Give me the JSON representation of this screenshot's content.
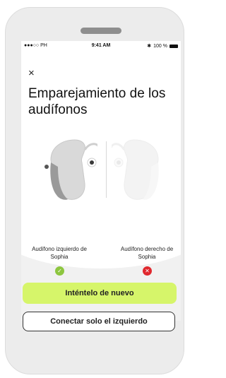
{
  "status_bar": {
    "carrier": "●●●○○ PH",
    "time": "9:41 AM",
    "battery": "100 %"
  },
  "header": {
    "close_label": "×",
    "title": "Emparejamiento de los audífonos"
  },
  "devices": {
    "left": {
      "label": "Audífono izquierdo de Sophia",
      "status": "success",
      "status_glyph": "✓",
      "status_color": "#8dc63f"
    },
    "right": {
      "label": "Audífono derecho de Sophia",
      "status": "error",
      "status_glyph": "✕",
      "status_color": "#e0282e"
    }
  },
  "actions": {
    "retry_label": "Inténtelo de nuevo",
    "connect_left_label": "Conectar solo el izquierdo"
  },
  "colors": {
    "accent": "#d6f56a",
    "success": "#8dc63f",
    "error": "#e0282e"
  }
}
